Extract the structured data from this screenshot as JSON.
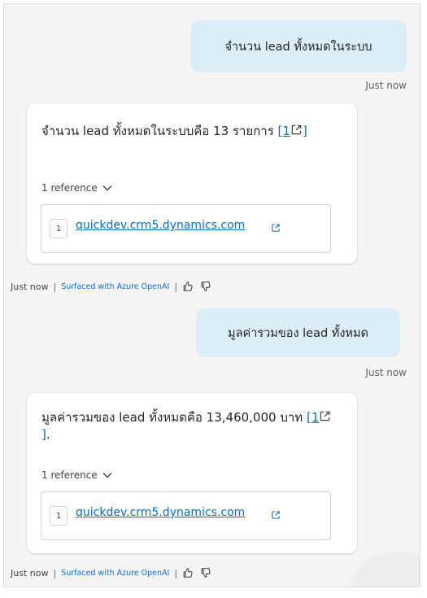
{
  "conversation": [
    {
      "user": {
        "text": "จำนวน lead ทั้งหมดในระบบ",
        "timestamp": "Just now"
      },
      "bot": {
        "answer_text": "จำนวน lead ทั้งหมดในระบบคือ 13 รายการ",
        "citation_open": "[",
        "citation_number": "1",
        "citation_close": "]",
        "answer_suffix": "",
        "references_label": "1 reference",
        "reference": {
          "index": "1",
          "url": "quickdev.crm5.dynamics.com"
        },
        "timestamp": "Just now",
        "surfaced_label": "Surfaced with Azure OpenAI"
      }
    },
    {
      "user": {
        "text": "มูลค่ารวมของ lead ทั้งหมด",
        "timestamp": "Just now"
      },
      "bot": {
        "answer_text": "มูลค่ารวมของ lead ทั้งหมดคือ 13,460,000 บาท",
        "citation_open": "[",
        "citation_number": "1",
        "citation_close": "]",
        "answer_suffix": ".",
        "references_label": "1 reference",
        "reference": {
          "index": "1",
          "url": "quickdev.crm5.dynamics.com"
        },
        "timestamp": "Just now",
        "surfaced_label": "Surfaced with Azure OpenAI"
      }
    }
  ],
  "separator": "|",
  "icons": {
    "external_link": "external-link-icon",
    "chevron": "chevron-down-icon",
    "like": "thumbs-up-icon",
    "dislike": "thumbs-down-icon"
  },
  "colors": {
    "user_bubble": "#dbeef7",
    "link": "#0f6cbd",
    "pane_background": "#f5f5f5"
  }
}
